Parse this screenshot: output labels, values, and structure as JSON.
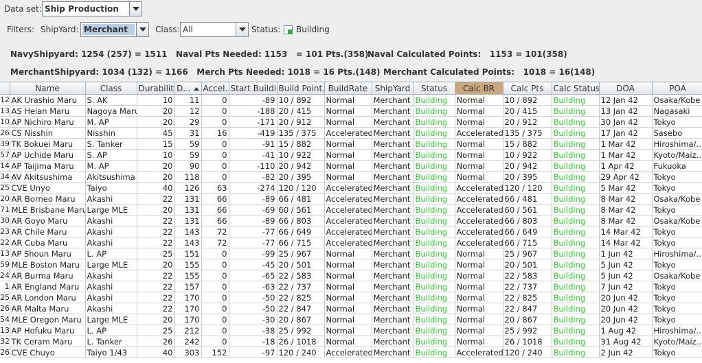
{
  "dataset": {
    "label": "Data set:",
    "value": "Ship Production"
  },
  "filters": {
    "label": "Filters:",
    "shipyard_label": "ShipYard:",
    "shipyard_value": "Merchant",
    "class_label": "Class:",
    "class_value": "All",
    "status_label": "Status:",
    "status_value": "Building"
  },
  "summary": {
    "navy_shipyard": "NavyShipyard: 1254 (257) = 1511",
    "naval_pts_needed": "Naval Pts Needed: 1153",
    "naval_pts_result": "= 101 Pts.(358)",
    "naval_calc": "Naval Calculated Points:",
    "naval_calc_value": "1153 = 101(358)",
    "merchant_shipyard": "MerchantShipyard: 1034 (132) = 1166",
    "merch_pts_needed": "Merch Pts Needed: 1018 =",
    "merch_pts_result": "16 Pts.(148)",
    "merchant_calc": "Merchant Calculated Points:",
    "merchant_calc_value": "1018 = 16(148)"
  },
  "colors": {
    "status_green": "#33cc33",
    "sorted_header": "#c9a87e"
  },
  "table": {
    "columns": [
      "",
      "Name",
      "Class",
      "Durability",
      "D...",
      "Accel...",
      "Start Buildi...",
      "Build Point...",
      "BuildRate",
      "ShipYard",
      "Status",
      "Calc BR",
      "Calc Pts",
      "Calc Status",
      "DOA",
      "POA"
    ],
    "rows": [
      [
        "12",
        "AK Urashio Maru",
        "S. AK",
        "10",
        "11",
        "0",
        "-89",
        "10 / 892",
        "Normal",
        "Merchant",
        "Building",
        "Normal",
        "10 / 892",
        "Building",
        "12 Jan 42",
        "Osaka/Kobe"
      ],
      [
        "13",
        "AS Heian Maru",
        "Nagoya Maru",
        "20",
        "12",
        "0",
        "-188",
        "20 / 415",
        "Normal",
        "Merchant",
        "Building",
        "Normal",
        "20 / 415",
        "Building",
        "13 Jan 42",
        "Nagasaki"
      ],
      [
        "10",
        "AP Nichiro Maru",
        "M. AP",
        "20",
        "29",
        "0",
        "-171",
        "20 / 912",
        "Normal",
        "Merchant",
        "Building",
        "Normal",
        "20 / 912",
        "Building",
        "30 Jan 42",
        "Tokyo"
      ],
      [
        "26",
        "CS Nisshin",
        "Nisshin",
        "45",
        "31",
        "16",
        "-419",
        "135 / 375",
        "Accelerated",
        "Merchant",
        "Building",
        "Accelerated",
        "135 / 375",
        "Building",
        "17 Jan 42",
        "Sasebo"
      ],
      [
        "39",
        "TK Bokuei Maru",
        "S. Tanker",
        "15",
        "59",
        "0",
        "-91",
        "15 / 882",
        "Normal",
        "Merchant",
        "Building",
        "Normal",
        "15 / 882",
        "Building",
        "1 Mar 42",
        "Hiroshima/..."
      ],
      [
        "57",
        "AP Uchide Maru",
        "S. AP",
        "10",
        "59",
        "0",
        "-41",
        "10 / 922",
        "Normal",
        "Merchant",
        "Building",
        "Normal",
        "10 / 922",
        "Building",
        "1 Mar 42",
        "Kyoto/Maiz..."
      ],
      [
        "14",
        "AP Taijima Maru",
        "M. AP",
        "20",
        "90",
        "0",
        "-110",
        "20 / 942",
        "Normal",
        "Merchant",
        "Building",
        "Normal",
        "20 / 942",
        "Building",
        "1 Apr 42",
        "Fukuoka"
      ],
      [
        "34",
        "AV Akitsushima",
        "Akitsushima",
        "20",
        "118",
        "0",
        "-82",
        "20 / 395",
        "Normal",
        "Merchant",
        "Building",
        "Normal",
        "20 / 395",
        "Building",
        "29 Apr 42",
        "Tokyo"
      ],
      [
        "25",
        "CVE Unyo",
        "Taiyo",
        "40",
        "126",
        "63",
        "-274",
        "120 / 120",
        "Accelerated",
        "Merchant",
        "Building",
        "Accelerated",
        "120 / 120",
        "Building",
        "5 Mar 42",
        "Tokyo"
      ],
      [
        "20",
        "AR Borneo Maru",
        "Akashi",
        "22",
        "131",
        "66",
        "-89",
        "66 / 481",
        "Accelerated",
        "Merchant",
        "Building",
        "Accelerated",
        "66 / 481",
        "Building",
        "8 Mar 42",
        "Osaka/Kobe"
      ],
      [
        "71",
        "MLE Brisbane Maru",
        "Large MLE",
        "20",
        "131",
        "66",
        "-69",
        "60 / 561",
        "Accelerated",
        "Merchant",
        "Building",
        "Accelerated",
        "60 / 561",
        "Building",
        "8 Mar 42",
        "Tokyo"
      ],
      [
        "30",
        "AR Goyo Maru",
        "Akashi",
        "22",
        "131",
        "66",
        "-89",
        "66 / 803",
        "Accelerated",
        "Merchant",
        "Building",
        "Accelerated",
        "66 / 803",
        "Building",
        "8 Mar 42",
        "Osaka/Kobe"
      ],
      [
        "23",
        "AR Chile Maru",
        "Akashi",
        "22",
        "143",
        "72",
        "-77",
        "66 / 649",
        "Accelerated",
        "Merchant",
        "Building",
        "Accelerated",
        "66 / 649",
        "Building",
        "14 Mar 42",
        "Tokyo"
      ],
      [
        "22",
        "AR Cuba Maru",
        "Akashi",
        "22",
        "143",
        "72",
        "-77",
        "66 / 715",
        "Accelerated",
        "Merchant",
        "Building",
        "Accelerated",
        "66 / 715",
        "Building",
        "14 Mar 42",
        "Tokyo"
      ],
      [
        "13",
        "AP Shoun Maru",
        "L. AP",
        "25",
        "151",
        "0",
        "-99",
        "25 / 967",
        "Normal",
        "Merchant",
        "Building",
        "Normal",
        "25 / 967",
        "Building",
        "1 Jun 42",
        "Hiroshima/..."
      ],
      [
        "59",
        "MLE Boston Maru",
        "Large MLE",
        "20",
        "155",
        "0",
        "-45",
        "20 / 501",
        "Normal",
        "Merchant",
        "Building",
        "Normal",
        "20 / 501",
        "Building",
        "5 Jun 42",
        "Tokyo"
      ],
      [
        "24",
        "AR Burma Maru",
        "Akashi",
        "22",
        "155",
        "0",
        "-65",
        "22 / 583",
        "Normal",
        "Merchant",
        "Building",
        "Normal",
        "22 / 583",
        "Building",
        "5 Jun 42",
        "Osaka/Kobe"
      ],
      [
        "1",
        "AR England Maru",
        "Akashi",
        "22",
        "157",
        "0",
        "-63",
        "22 / 737",
        "Normal",
        "Merchant",
        "Building",
        "Normal",
        "22 / 737",
        "Building",
        "7 Jun 42",
        "Tokyo"
      ],
      [
        "25",
        "AR London Maru",
        "Akashi",
        "22",
        "170",
        "0",
        "-50",
        "22 / 825",
        "Normal",
        "Merchant",
        "Building",
        "Normal",
        "22 / 825",
        "Building",
        "20 Jun 42",
        "Tokyo"
      ],
      [
        "26",
        "AR Malta Maru",
        "Akashi",
        "22",
        "170",
        "0",
        "-50",
        "22 / 847",
        "Normal",
        "Merchant",
        "Building",
        "Normal",
        "22 / 847",
        "Building",
        "20 Jun 42",
        "Tokyo"
      ],
      [
        "54",
        "MLE Oregon Maru",
        "Large MLE",
        "20",
        "170",
        "0",
        "-30",
        "20 / 867",
        "Normal",
        "Merchant",
        "Building",
        "Normal",
        "20 / 867",
        "Building",
        "20 Jun 42",
        "Tokyo"
      ],
      [
        "13",
        "AP Hofuku Maru",
        "L. AP",
        "25",
        "212",
        "0",
        "-38",
        "25 / 992",
        "Normal",
        "Merchant",
        "Building",
        "Normal",
        "25 / 992",
        "Building",
        "1 Aug 42",
        "Hiroshima/..."
      ],
      [
        "32",
        "TK Ceram Maru",
        "L. Tanker",
        "26",
        "242",
        "0",
        "-18",
        "26 / 1018",
        "Normal",
        "Merchant",
        "Building",
        "Normal",
        "26 / 1018",
        "Building",
        "31 Aug 42",
        "Kyoto/Maiz..."
      ],
      [
        "26",
        "CVE Chuyo",
        "Taiyo 1/43",
        "40",
        "303",
        "152",
        "-97",
        "120 / 240",
        "Accelerated",
        "Merchant",
        "Building",
        "Accelerated",
        "120 / 240",
        "Building",
        "2 Jun 42",
        "Tokyo"
      ]
    ]
  }
}
